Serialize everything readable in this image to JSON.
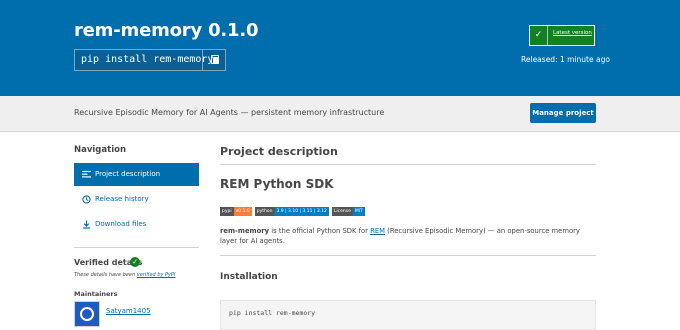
{
  "package": {
    "title": "rem-memory 0.1.0",
    "pip_command": "pip install rem-memory",
    "status_link": "Latest version",
    "released": "Released: 1 minute ago"
  },
  "summary": {
    "text": "Recursive Episodic Memory for AI Agents — persistent memory infrastructure",
    "manage_label": "Manage project"
  },
  "sidebar": {
    "nav_heading": "Navigation",
    "items": [
      {
        "label": "Project description",
        "icon": "align-left-icon",
        "active": true
      },
      {
        "label": "Release history",
        "icon": "history-icon",
        "active": false
      },
      {
        "label": "Download files",
        "icon": "download-icon",
        "active": false
      }
    ],
    "verified_heading": "Verified details",
    "verified_note_prefix": "These details have been ",
    "verified_note_link": "verified by PyPI",
    "maintainers_heading": "Maintainers",
    "maintainer_name": "Satyam1405"
  },
  "content": {
    "section_title": "Project description",
    "readme_title": "REM Python SDK",
    "badges": [
      {
        "left": "pypi",
        "right": "v0.1.0",
        "color": "#fe7d37"
      },
      {
        "left": "python",
        "right": "3.9 | 3.10 | 3.11 | 3.12",
        "color": "#007ec6"
      },
      {
        "left": "License",
        "right": "MIT",
        "color": "#007ec6"
      }
    ],
    "intro_bold": "rem-memory",
    "intro_mid": " is the official Python SDK for ",
    "intro_link": "REM",
    "intro_rest": " (Recursive Episodic Memory) — an open-source memory layer for AI agents.",
    "install_heading": "Installation",
    "install_code": "pip install rem-memory"
  },
  "colors": {
    "brand_blue": "#006dad",
    "success_green": "#148024"
  }
}
